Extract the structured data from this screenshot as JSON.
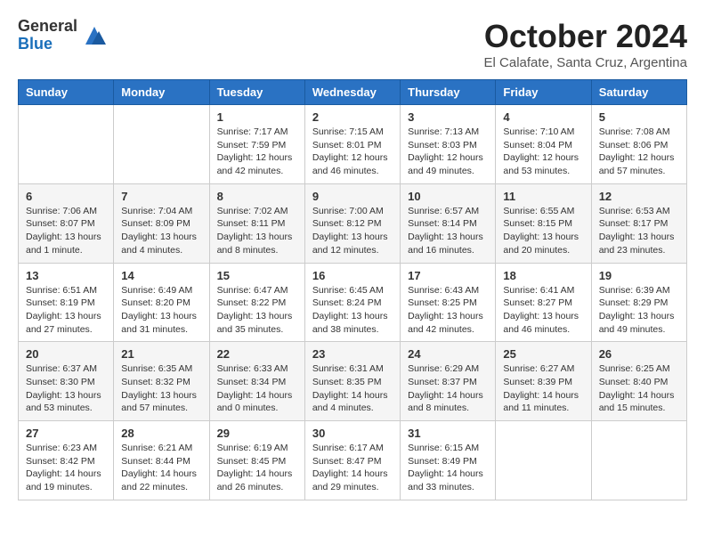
{
  "logo": {
    "general": "General",
    "blue": "Blue"
  },
  "title": "October 2024",
  "subtitle": "El Calafate, Santa Cruz, Argentina",
  "days_header": [
    "Sunday",
    "Monday",
    "Tuesday",
    "Wednesday",
    "Thursday",
    "Friday",
    "Saturday"
  ],
  "weeks": [
    [
      {
        "day": "",
        "info": ""
      },
      {
        "day": "",
        "info": ""
      },
      {
        "day": "1",
        "info": "Sunrise: 7:17 AM\nSunset: 7:59 PM\nDaylight: 12 hours\nand 42 minutes."
      },
      {
        "day": "2",
        "info": "Sunrise: 7:15 AM\nSunset: 8:01 PM\nDaylight: 12 hours\nand 46 minutes."
      },
      {
        "day": "3",
        "info": "Sunrise: 7:13 AM\nSunset: 8:03 PM\nDaylight: 12 hours\nand 49 minutes."
      },
      {
        "day": "4",
        "info": "Sunrise: 7:10 AM\nSunset: 8:04 PM\nDaylight: 12 hours\nand 53 minutes."
      },
      {
        "day": "5",
        "info": "Sunrise: 7:08 AM\nSunset: 8:06 PM\nDaylight: 12 hours\nand 57 minutes."
      }
    ],
    [
      {
        "day": "6",
        "info": "Sunrise: 7:06 AM\nSunset: 8:07 PM\nDaylight: 13 hours\nand 1 minute."
      },
      {
        "day": "7",
        "info": "Sunrise: 7:04 AM\nSunset: 8:09 PM\nDaylight: 13 hours\nand 4 minutes."
      },
      {
        "day": "8",
        "info": "Sunrise: 7:02 AM\nSunset: 8:11 PM\nDaylight: 13 hours\nand 8 minutes."
      },
      {
        "day": "9",
        "info": "Sunrise: 7:00 AM\nSunset: 8:12 PM\nDaylight: 13 hours\nand 12 minutes."
      },
      {
        "day": "10",
        "info": "Sunrise: 6:57 AM\nSunset: 8:14 PM\nDaylight: 13 hours\nand 16 minutes."
      },
      {
        "day": "11",
        "info": "Sunrise: 6:55 AM\nSunset: 8:15 PM\nDaylight: 13 hours\nand 20 minutes."
      },
      {
        "day": "12",
        "info": "Sunrise: 6:53 AM\nSunset: 8:17 PM\nDaylight: 13 hours\nand 23 minutes."
      }
    ],
    [
      {
        "day": "13",
        "info": "Sunrise: 6:51 AM\nSunset: 8:19 PM\nDaylight: 13 hours\nand 27 minutes."
      },
      {
        "day": "14",
        "info": "Sunrise: 6:49 AM\nSunset: 8:20 PM\nDaylight: 13 hours\nand 31 minutes."
      },
      {
        "day": "15",
        "info": "Sunrise: 6:47 AM\nSunset: 8:22 PM\nDaylight: 13 hours\nand 35 minutes."
      },
      {
        "day": "16",
        "info": "Sunrise: 6:45 AM\nSunset: 8:24 PM\nDaylight: 13 hours\nand 38 minutes."
      },
      {
        "day": "17",
        "info": "Sunrise: 6:43 AM\nSunset: 8:25 PM\nDaylight: 13 hours\nand 42 minutes."
      },
      {
        "day": "18",
        "info": "Sunrise: 6:41 AM\nSunset: 8:27 PM\nDaylight: 13 hours\nand 46 minutes."
      },
      {
        "day": "19",
        "info": "Sunrise: 6:39 AM\nSunset: 8:29 PM\nDaylight: 13 hours\nand 49 minutes."
      }
    ],
    [
      {
        "day": "20",
        "info": "Sunrise: 6:37 AM\nSunset: 8:30 PM\nDaylight: 13 hours\nand 53 minutes."
      },
      {
        "day": "21",
        "info": "Sunrise: 6:35 AM\nSunset: 8:32 PM\nDaylight: 13 hours\nand 57 minutes."
      },
      {
        "day": "22",
        "info": "Sunrise: 6:33 AM\nSunset: 8:34 PM\nDaylight: 14 hours\nand 0 minutes."
      },
      {
        "day": "23",
        "info": "Sunrise: 6:31 AM\nSunset: 8:35 PM\nDaylight: 14 hours\nand 4 minutes."
      },
      {
        "day": "24",
        "info": "Sunrise: 6:29 AM\nSunset: 8:37 PM\nDaylight: 14 hours\nand 8 minutes."
      },
      {
        "day": "25",
        "info": "Sunrise: 6:27 AM\nSunset: 8:39 PM\nDaylight: 14 hours\nand 11 minutes."
      },
      {
        "day": "26",
        "info": "Sunrise: 6:25 AM\nSunset: 8:40 PM\nDaylight: 14 hours\nand 15 minutes."
      }
    ],
    [
      {
        "day": "27",
        "info": "Sunrise: 6:23 AM\nSunset: 8:42 PM\nDaylight: 14 hours\nand 19 minutes."
      },
      {
        "day": "28",
        "info": "Sunrise: 6:21 AM\nSunset: 8:44 PM\nDaylight: 14 hours\nand 22 minutes."
      },
      {
        "day": "29",
        "info": "Sunrise: 6:19 AM\nSunset: 8:45 PM\nDaylight: 14 hours\nand 26 minutes."
      },
      {
        "day": "30",
        "info": "Sunrise: 6:17 AM\nSunset: 8:47 PM\nDaylight: 14 hours\nand 29 minutes."
      },
      {
        "day": "31",
        "info": "Sunrise: 6:15 AM\nSunset: 8:49 PM\nDaylight: 14 hours\nand 33 minutes."
      },
      {
        "day": "",
        "info": ""
      },
      {
        "day": "",
        "info": ""
      }
    ]
  ]
}
